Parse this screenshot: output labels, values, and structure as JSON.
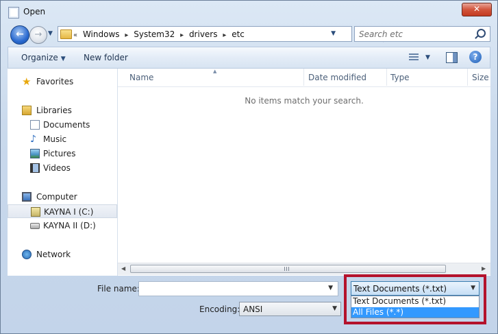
{
  "window": {
    "title": "Open",
    "close_glyph": "✕"
  },
  "nav": {
    "back_glyph": "←",
    "forward_glyph": "→",
    "history_arrow": "▼",
    "crumb_prefix": "«",
    "breadcrumbs": [
      "Windows",
      "System32",
      "drivers",
      "etc"
    ],
    "crumb_separator": "▸",
    "address_dropdown": "▼",
    "refresh_glyph": "⇆",
    "search_placeholder": "Search etc"
  },
  "toolbar": {
    "organize_label": "Organize",
    "new_folder_label": "New folder",
    "caret": "▼",
    "help_glyph": "?"
  },
  "sidebar": {
    "favorites": "Favorites",
    "libraries": "Libraries",
    "library_items": [
      "Documents",
      "Music",
      "Pictures",
      "Videos"
    ],
    "computer": "Computer",
    "drives": [
      "KAYNA I (C:)",
      "KAYNA II (D:)"
    ],
    "network": "Network",
    "star_glyph": "★",
    "music_glyph": "♪"
  },
  "file_list": {
    "columns": [
      "Name",
      "Date modified",
      "Type",
      "Size"
    ],
    "sort_arrow": "▲",
    "empty_message": "No items match your search.",
    "scroll_left": "◀",
    "scroll_right": "▶"
  },
  "footer": {
    "filename_label": "File name:",
    "filename_value": "",
    "encoding_label": "Encoding:",
    "encoding_value": "ANSI",
    "filetype_value": "Text Documents (*.txt)",
    "filetype_options": [
      "Text Documents (*.txt)",
      "All Files  (*.*)"
    ],
    "drop_glyph": "▼"
  },
  "colors": {
    "highlight_box": "#b4122c",
    "selected_option": "#3399ff",
    "close_button": "#c43b20"
  }
}
